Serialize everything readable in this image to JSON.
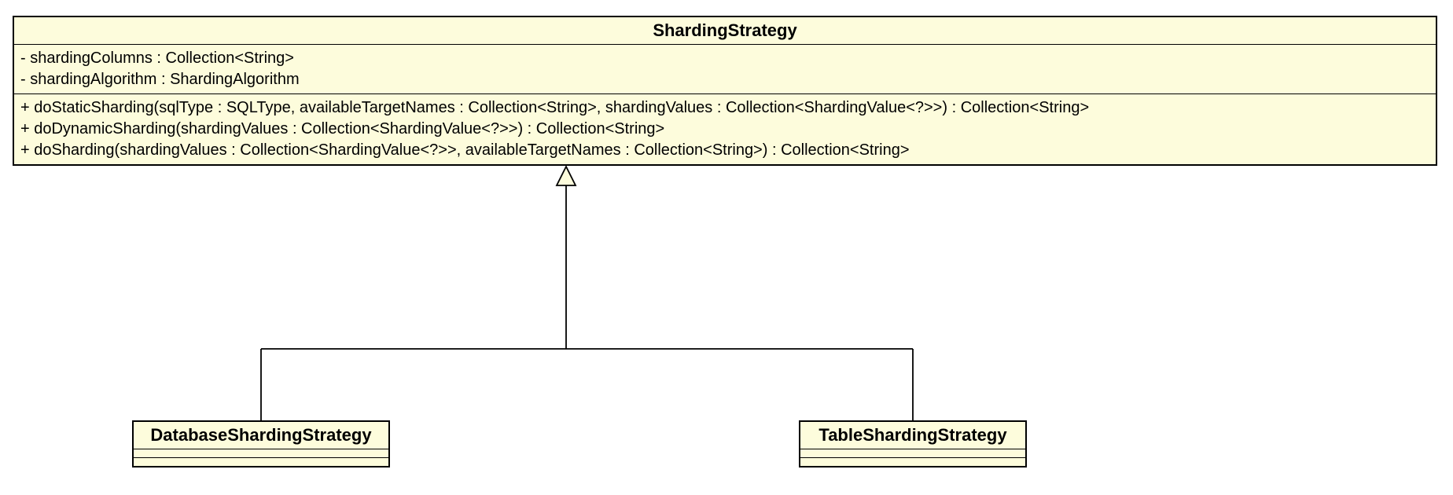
{
  "parent": {
    "name": "ShardingStrategy",
    "attributes": [
      "- shardingColumns : Collection<String>",
      "- shardingAlgorithm : ShardingAlgorithm"
    ],
    "operations": [
      "+ doStaticSharding(sqlType : SQLType, availableTargetNames : Collection<String>, shardingValues : Collection<ShardingValue<?>>) : Collection<String>",
      "+ doDynamicSharding(shardingValues : Collection<ShardingValue<?>>) : Collection<String>",
      "+ doSharding(shardingValues : Collection<ShardingValue<?>>, availableTargetNames : Collection<String>) : Collection<String>"
    ]
  },
  "childLeft": {
    "name": "DatabaseShardingStrategy"
  },
  "childRight": {
    "name": "TableShardingStrategy"
  }
}
